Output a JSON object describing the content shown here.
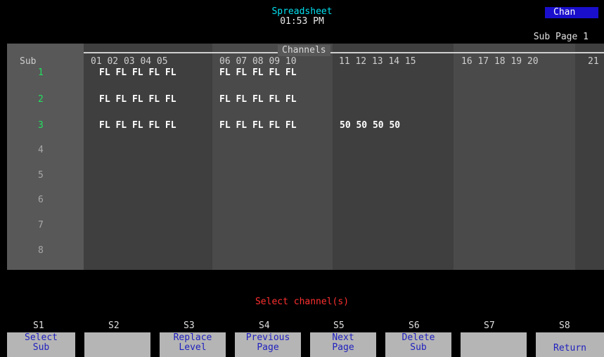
{
  "header": {
    "title": "Spreadsheet",
    "clock": "01:53 PM",
    "mode": "Chan",
    "sub_page": "Sub Page 1"
  },
  "grid": {
    "channels_label": "Channels",
    "sub_header": "Sub",
    "column_groups": [
      "01 02 03 04 05",
      "06 07 08 09 10",
      "11 12 13 14 15",
      "16 17 18 19 20",
      "21"
    ],
    "subs": [
      {
        "num": "1",
        "cells": [
          "FL FL FL FL FL",
          "FL FL FL FL FL",
          "",
          ""
        ]
      },
      {
        "num": "2",
        "cells": [
          "FL FL FL FL FL",
          "FL FL FL FL FL",
          "",
          ""
        ]
      },
      {
        "num": "3",
        "cells": [
          "FL FL FL FL FL",
          "FL FL FL FL FL",
          "50 50 50 50",
          ""
        ]
      },
      {
        "num": "4",
        "cells": [
          "",
          "",
          "",
          ""
        ]
      },
      {
        "num": "5",
        "cells": [
          "",
          "",
          "",
          ""
        ]
      },
      {
        "num": "6",
        "cells": [
          "",
          "",
          "",
          ""
        ]
      },
      {
        "num": "7",
        "cells": [
          "",
          "",
          "",
          ""
        ]
      },
      {
        "num": "8",
        "cells": [
          "",
          "",
          "",
          ""
        ]
      }
    ]
  },
  "prompt": "Select channel(s)",
  "softkeys": [
    {
      "id": "S1",
      "line1": "Select",
      "line2": "Sub"
    },
    {
      "id": "S2",
      "line1": "",
      "line2": ""
    },
    {
      "id": "S3",
      "line1": "Replace",
      "line2": "Level"
    },
    {
      "id": "S4",
      "line1": "Previous",
      "line2": "Page"
    },
    {
      "id": "S5",
      "line1": "Next",
      "line2": "Page"
    },
    {
      "id": "S6",
      "line1": "Delete",
      "line2": "Sub"
    },
    {
      "id": "S7",
      "line1": "",
      "line2": ""
    },
    {
      "id": "S8",
      "line1": "",
      "line2": "Return"
    }
  ],
  "colors": {
    "title": "#00e0f0",
    "active_sub": "#22e060",
    "prompt": "#ff3030",
    "mode_badge": "#1a0fcc",
    "softkey_bg": "#b5b5b5",
    "softkey_text": "#1f1fbf"
  }
}
